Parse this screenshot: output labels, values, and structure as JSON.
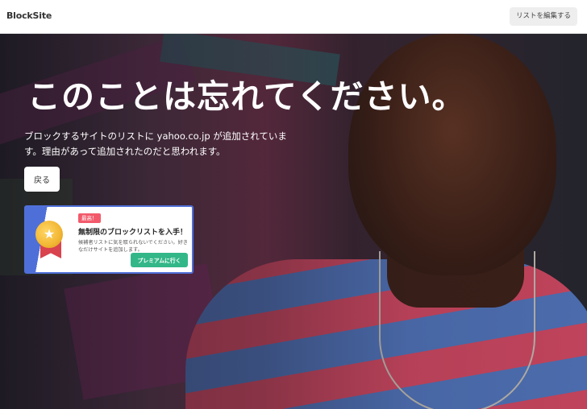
{
  "header": {
    "logo": "BlockSite",
    "edit_list_button": "リストを編集する"
  },
  "main": {
    "headline": "このことは忘れてください。",
    "description": "ブロックするサイトのリストに yahoo.co.jp が追加されています。理由があって追加されたのだと思われます。",
    "back_button": "戻る"
  },
  "promo": {
    "badge": "最高！",
    "title": "無制限のブロックリストを入手！",
    "body": "候補者リストに気を取られないでください。好きなだけサイトを追加します。",
    "cta_button": "プレミアムに行く",
    "icon": "medal-star-icon",
    "accent_color": "#4f6fd8",
    "cta_color": "#33b789"
  }
}
